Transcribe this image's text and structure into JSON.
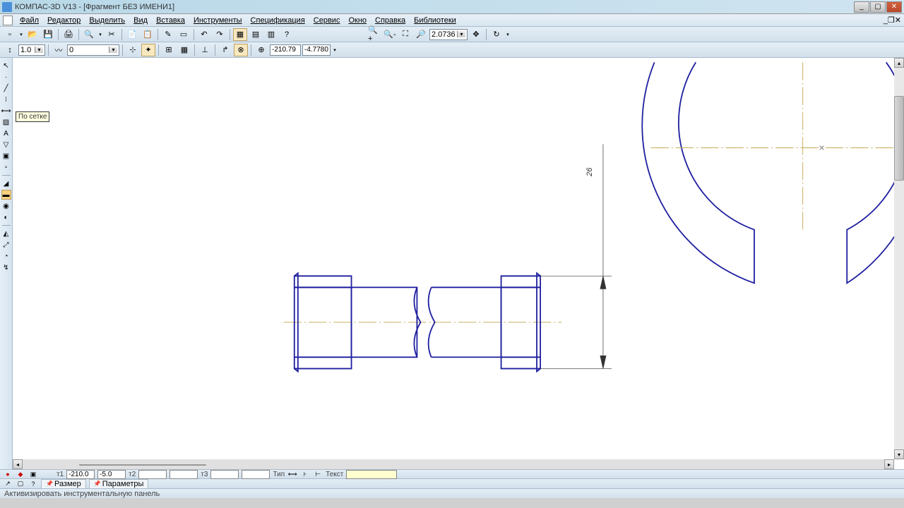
{
  "title": "КОМПАС-3D V13 - [Фрагмент БЕЗ ИМЕНИ1]",
  "menu": {
    "items": [
      "Файл",
      "Редактор",
      "Выделить",
      "Вид",
      "Вставка",
      "Инструменты",
      "Спецификация",
      "Сервис",
      "Окно",
      "Справка",
      "Библиотеки"
    ]
  },
  "toolbar1": {
    "zoom": "2.0736",
    "coord_x": "-210.79",
    "coord_y": "-4.7780"
  },
  "toolbar2": {
    "step": "1.0",
    "style": "0"
  },
  "tooltip": "По сетке",
  "dim_value": "26",
  "bottom": {
    "t1_label": "т1",
    "t1_x": "-210.0",
    "t1_y": "-5.0",
    "t2_label": "т2",
    "t3_label": "т3",
    "type_label": "Тип",
    "text_label": "Текст",
    "text_value": ""
  },
  "tabs": {
    "size": "Размер",
    "params": "Параметры"
  },
  "status": "Активизировать инструментальную панель"
}
